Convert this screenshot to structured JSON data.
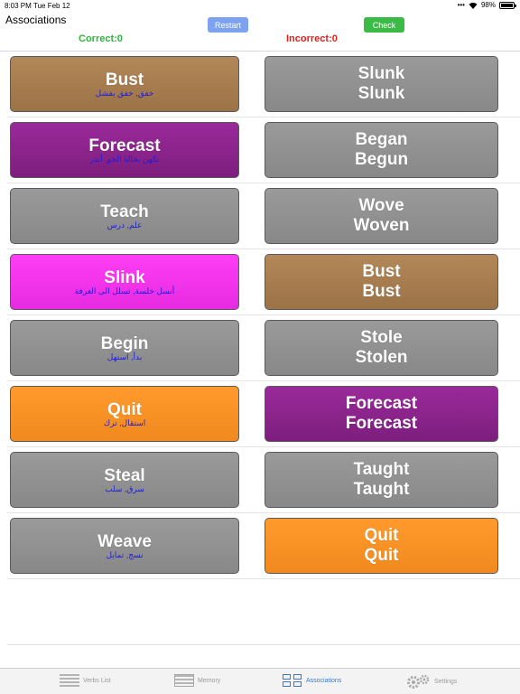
{
  "status_bar": {
    "time": "8:03 PM",
    "date": "Tue Feb 12",
    "battery": "98%"
  },
  "header": {
    "title": "Associations",
    "restart_label": "Restart",
    "check_label": "Check",
    "correct_label": "Correct:0",
    "incorrect_label": "Incorrect:0"
  },
  "colors": {
    "gray": "#909090",
    "brown": "#a77d50",
    "purple": "#8b258c",
    "magenta": "#f034ea",
    "orange": "#f89226",
    "correct": "#2db53c",
    "incorrect": "#e0201a",
    "arabic_text": "#1c1cde"
  },
  "rows": [
    {
      "left": {
        "word": "Bust",
        "arabic": "خفق, خفق يفشل",
        "color": "brown"
      },
      "right": {
        "line1": "Slunk",
        "line2": "Slunk",
        "color": "gray"
      }
    },
    {
      "left": {
        "word": "Forecast",
        "arabic": "تكهن بحالة الجو, أنذر",
        "color": "purple"
      },
      "right": {
        "line1": "Began",
        "line2": "Begun",
        "color": "gray"
      }
    },
    {
      "left": {
        "word": "Teach",
        "arabic": "علم, درس",
        "color": "gray"
      },
      "right": {
        "line1": "Wove",
        "line2": "Woven",
        "color": "gray"
      }
    },
    {
      "left": {
        "word": "Slink",
        "arabic": "أنسل خلسة, تسلل الى الغرفة",
        "color": "magenta"
      },
      "right": {
        "line1": "Bust",
        "line2": "Bust",
        "color": "brown"
      }
    },
    {
      "left": {
        "word": "Begin",
        "arabic": "بدأ, استهل",
        "color": "gray"
      },
      "right": {
        "line1": "Stole",
        "line2": "Stolen",
        "color": "gray"
      }
    },
    {
      "left": {
        "word": "Quit",
        "arabic": "استقال, ترك",
        "color": "orange"
      },
      "right": {
        "line1": "Forecast",
        "line2": "Forecast",
        "color": "purple"
      }
    },
    {
      "left": {
        "word": "Steal",
        "arabic": "سرق, سلب",
        "color": "gray"
      },
      "right": {
        "line1": "Taught",
        "line2": "Taught",
        "color": "gray"
      }
    },
    {
      "left": {
        "word": "Weave",
        "arabic": "نسج, تمايل",
        "color": "gray"
      },
      "right": {
        "line1": "Quit",
        "line2": "Quit",
        "color": "orange"
      }
    }
  ],
  "tabbar": {
    "tabs": [
      {
        "label": "Verbs List",
        "icon": "list-icon",
        "active": false
      },
      {
        "label": "Memory",
        "icon": "memory-icon",
        "active": false
      },
      {
        "label": "Associations",
        "icon": "associations-icon",
        "active": true
      },
      {
        "label": "Settings",
        "icon": "gear-icon",
        "active": false
      }
    ]
  }
}
